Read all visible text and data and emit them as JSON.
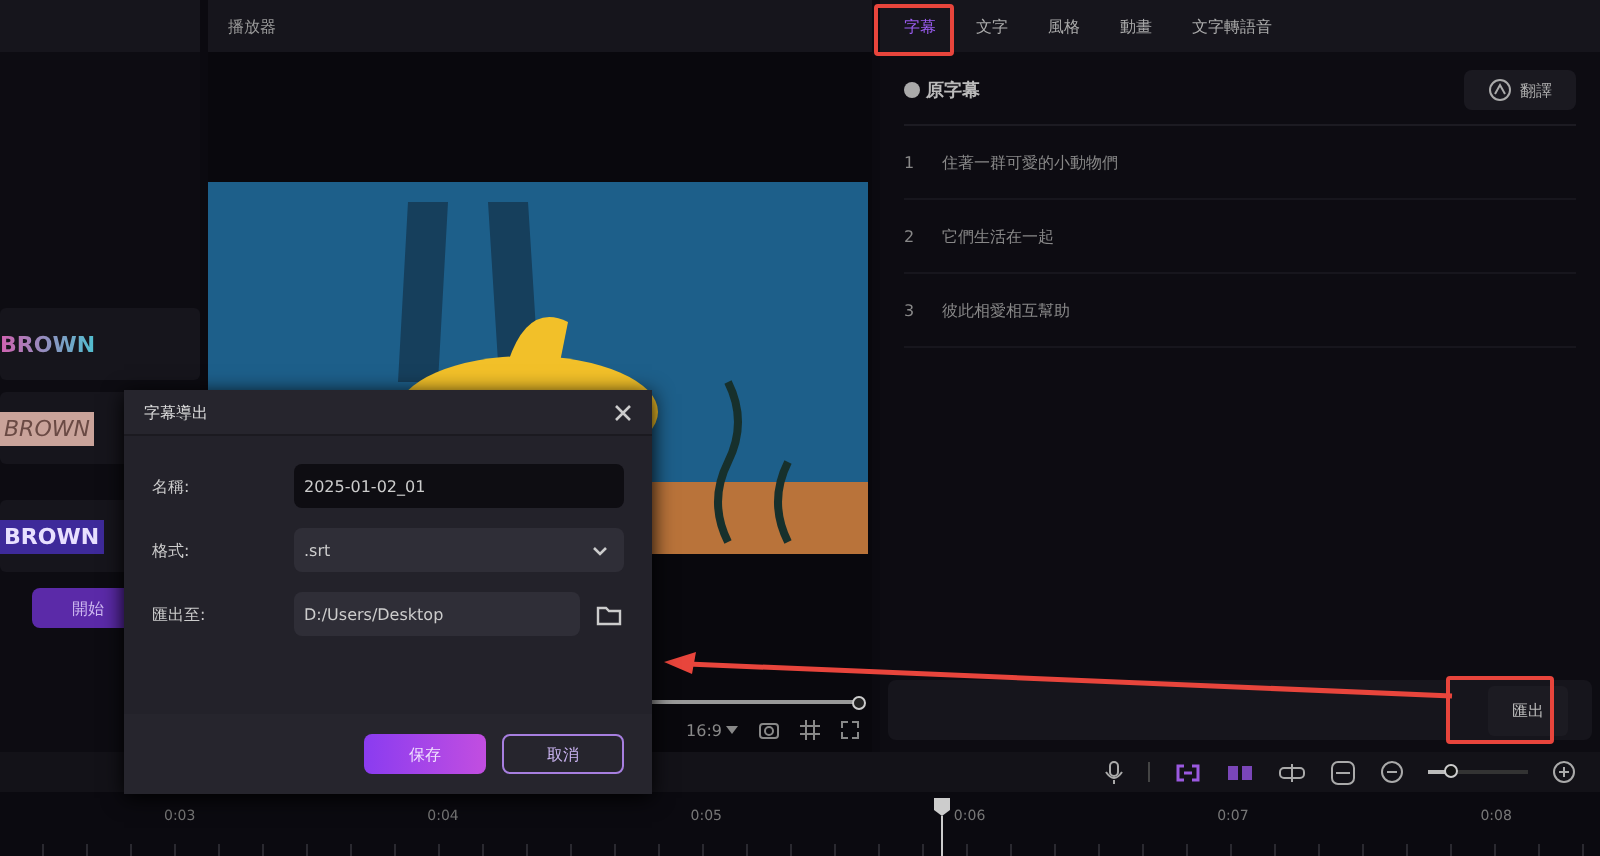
{
  "left_panel": {
    "styles": [
      {
        "label": "BROWN",
        "kind": "gradient"
      },
      {
        "label": "BROWN",
        "kind": "outline"
      },
      {
        "label": "BROWN",
        "kind": "block"
      }
    ],
    "start_button": "開始"
  },
  "player": {
    "title": "播放器",
    "progress": {
      "level": 1
    },
    "aspect_ratio": "16:9"
  },
  "right_panel": {
    "tabs": [
      {
        "label": "字幕",
        "selected": true
      },
      {
        "label": "文字",
        "selected": false
      },
      {
        "label": "風格",
        "selected": false
      },
      {
        "label": "動畫",
        "selected": false
      },
      {
        "label": "文字轉語音",
        "selected": false
      }
    ],
    "section_title": "原字幕",
    "translate_button": "翻譯",
    "subtitles": [
      {
        "index": "1",
        "text": "住著一群可愛的小動物們"
      },
      {
        "index": "2",
        "text": "它們生活在一起"
      },
      {
        "index": "3",
        "text": "彼此相愛相互幫助"
      }
    ],
    "export_button": "匯出"
  },
  "timeline": {
    "zoom": {
      "level": 0.22
    },
    "ticks": [
      "0:03",
      "0:04",
      "0:05",
      "0:06",
      "0:07",
      "0:08"
    ]
  },
  "dialog": {
    "title": "字幕導出",
    "fields": [
      {
        "kind": "text",
        "label": "名稱:",
        "value": "2025-01-02_01"
      },
      {
        "kind": "select",
        "label": "格式:",
        "value": ".srt"
      },
      {
        "kind": "folder",
        "label": "匯出至:",
        "value": "D:/Users/Desktop"
      }
    ],
    "save_button": "保存",
    "cancel_button": "取消"
  }
}
